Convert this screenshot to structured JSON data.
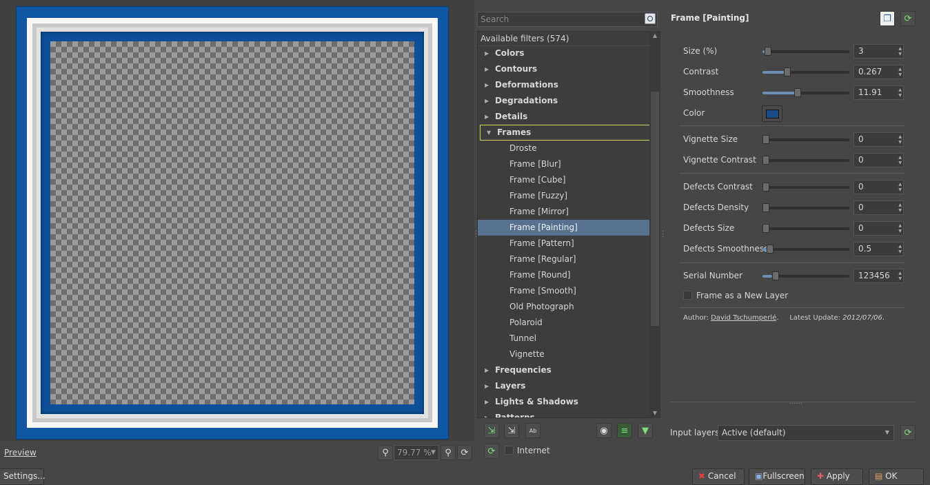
{
  "preview": {
    "label": "Preview",
    "zoom": "79.77 %"
  },
  "settings_button": "Settings...",
  "search": {
    "placeholder": "Search"
  },
  "filters": {
    "header": "Available filters (574)",
    "items": [
      {
        "label": "Colors",
        "type": "category"
      },
      {
        "label": "Contours",
        "type": "category"
      },
      {
        "label": "Deformations",
        "type": "category"
      },
      {
        "label": "Degradations",
        "type": "category"
      },
      {
        "label": "Details",
        "type": "category"
      },
      {
        "label": "Frames",
        "type": "category",
        "expanded": true
      },
      {
        "label": "Droste",
        "type": "filter"
      },
      {
        "label": "Frame [Blur]",
        "type": "filter"
      },
      {
        "label": "Frame [Cube]",
        "type": "filter"
      },
      {
        "label": "Frame [Fuzzy]",
        "type": "filter"
      },
      {
        "label": "Frame [Mirror]",
        "type": "filter"
      },
      {
        "label": "Frame [Painting]",
        "type": "filter",
        "selected": true
      },
      {
        "label": "Frame [Pattern]",
        "type": "filter"
      },
      {
        "label": "Frame [Regular]",
        "type": "filter"
      },
      {
        "label": "Frame [Round]",
        "type": "filter"
      },
      {
        "label": "Frame [Smooth]",
        "type": "filter"
      },
      {
        "label": "Old Photograph",
        "type": "filter"
      },
      {
        "label": "Polaroid",
        "type": "filter"
      },
      {
        "label": "Tunnel",
        "type": "filter"
      },
      {
        "label": "Vignette",
        "type": "filter"
      },
      {
        "label": "Frequencies",
        "type": "category"
      },
      {
        "label": "Layers",
        "type": "category"
      },
      {
        "label": "Lights & Shadows",
        "type": "category"
      },
      {
        "label": "Patterns",
        "type": "category"
      }
    ]
  },
  "internet_label": "Internet",
  "filter_title": "Frame [Painting]",
  "params": {
    "size": {
      "label": "Size (%)",
      "value": "3",
      "level": 0.03
    },
    "contrast": {
      "label": "Contrast",
      "value": "0.267",
      "level": 0.27
    },
    "smoothness": {
      "label": "Smoothness",
      "value": "11.91",
      "level": 0.4
    },
    "color": {
      "label": "Color",
      "hex": "#1b4c87"
    },
    "vignette_size": {
      "label": "Vignette Size",
      "value": "0",
      "level": 0
    },
    "vignette_contrast": {
      "label": "Vignette Contrast",
      "value": "0",
      "level": 0
    },
    "defects_contrast": {
      "label": "Defects Contrast",
      "value": "0",
      "level": 0
    },
    "defects_density": {
      "label": "Defects Density",
      "value": "0",
      "level": 0
    },
    "defects_size": {
      "label": "Defects Size",
      "value": "0",
      "level": 0
    },
    "defects_smoothness": {
      "label": "Defects Smoothness",
      "value": "0.5",
      "level": 0.05
    },
    "serial_number": {
      "label": "Serial Number",
      "value": "123456",
      "level": 0.12
    },
    "new_layer": {
      "label": "Frame as a New Layer"
    }
  },
  "author": {
    "prefix": "Author:",
    "name": "David Tschumperlé",
    "update_prefix": "Latest Update:",
    "date": "2012/07/06"
  },
  "input_layers": {
    "label": "Input layers",
    "value": "Active (default)"
  },
  "buttons": {
    "cancel": "Cancel",
    "fullscreen": "Fullscreen",
    "apply": "Apply",
    "ok": "OK"
  },
  "colors": {
    "selection": "#58718f",
    "frame_blue": "#0f57a2"
  }
}
